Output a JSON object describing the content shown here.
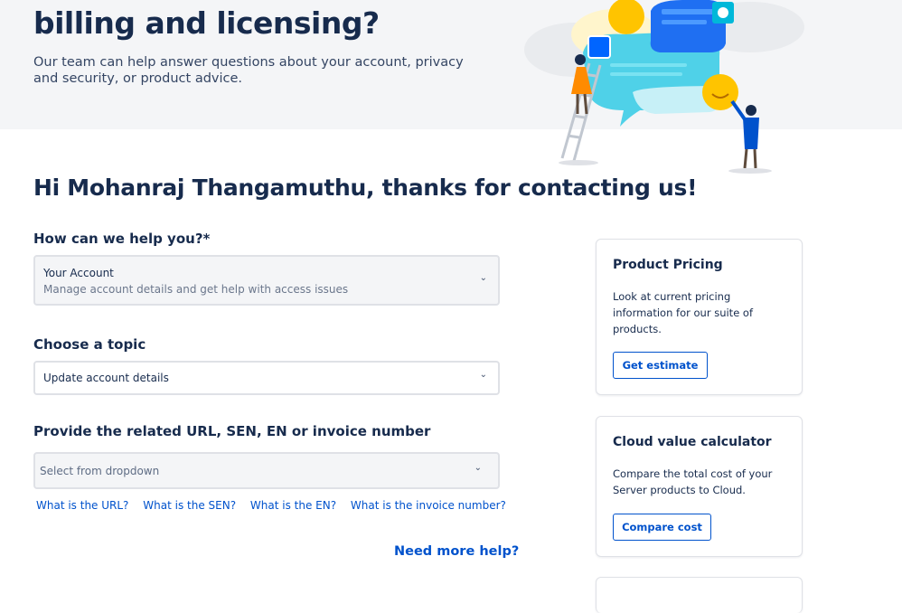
{
  "hero": {
    "title_line2": "billing and licensing?",
    "description": "Our team can help answer questions about your account, privacy and security, or product advice."
  },
  "greeting": "Hi Mohanraj Thangamuthu, thanks for contacting us!",
  "help_select": {
    "label": "How can we help you?*",
    "value": "Your Account",
    "sub": "Manage account details and get help with access issues"
  },
  "topic_select": {
    "label": "Choose a topic",
    "value": "Update account details"
  },
  "url_select": {
    "label": "Provide the related URL, SEN, EN or invoice number",
    "placeholder": "Select from dropdown"
  },
  "help_links": [
    "What is the URL?",
    "What is the SEN?",
    "What is the EN?",
    "What is the invoice number?"
  ],
  "need_more_help": "Need more help?",
  "cards": [
    {
      "title": "Product Pricing",
      "body": "Look at current pricing information for our suite of products.",
      "button": "Get estimate"
    },
    {
      "title": "Cloud value calculator",
      "body": "Compare the total cost of your Server products to Cloud.",
      "button": "Compare cost"
    }
  ],
  "colors": {
    "link": "#0052cc",
    "text": "#172b4d",
    "hero_bg": "#f4f5f7"
  },
  "icons": [
    "chevron-down-icon",
    "support-illustration"
  ]
}
